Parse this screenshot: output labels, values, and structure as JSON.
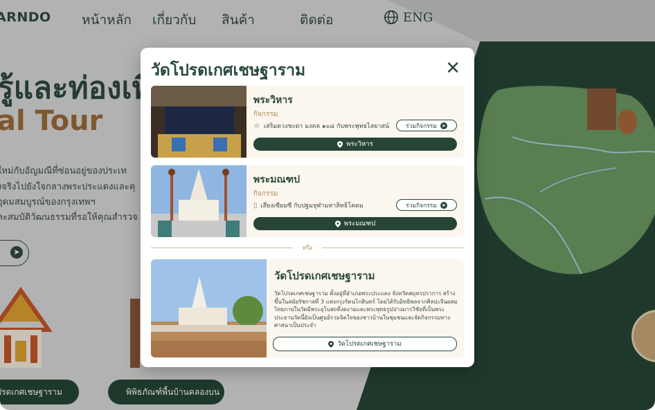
{
  "header": {
    "brand": "ARNDO",
    "nav": [
      "หน้าหลัก",
      "เกี่ยวกับ",
      "สินค้า",
      "ติดต่อ"
    ],
    "lang": "ENG"
  },
  "hero": {
    "title": "รู้และท่องเที่",
    "subtitle": "al Tour",
    "paragraph": [
      "ใหม่กับอัญมณีที่ซ่อนอยู่ของประเท",
      "งจริงไปยังใจกลางพระประแดงและคุ",
      "อุดมสมบูรณ์ของกรุงเทพฯ",
      "ละสมบัติวัฒนธรรมที่รอให้คุณสำรวจ"
    ],
    "pill_left": "โปรดเกศเชษฐาราม",
    "pill_right": "พิพิธภัณฑ์พื้นบ้านคลองบน"
  },
  "modal": {
    "title": "วัดโปรดเกศเชษฐาราม",
    "cards": [
      {
        "title": "พระวิหาร",
        "type": "กิจกรรม",
        "desc": "เสริมดวงชะตา มงคล ๑๐๘ กับพระพุทธไสยาสน์",
        "join": "ร่วมกิจกรรม",
        "location": "พระวิหาร"
      },
      {
        "title": "พระมณฑป",
        "type": "กิจกรรม",
        "desc": "เสี่ยงเซียมซี กับปฐมจุฬามหาสิทธิโคดม",
        "join": "ร่วมกิจกรรม",
        "location": "พระมณฑป"
      }
    ],
    "divider": "หรือ",
    "temple": {
      "title": "วัดโปรดเกศเชษฐาราม",
      "body": "วัดโปรดเกศเชษฐาราม ตั้งอยู่ที่อำเภอพระประแดง จังหวัดสมุทรปราการ สร้างขึ้นในสมัยรัชกาลที่ 3 แห่งกรุงรัตนโกสินทร์ โดยได้รับอิทธิพลจากศิลปะจีนผสมไทยภายในวัดมีพระอุโบสถที่งดงามและพระพุทธรูปปางมารวิชัยที่เป็นพระประธานวัดนี้ยังเป็นศูนย์รวมจิตใจของชาวบ้านในชุมชนและจัดกิจกรรมทางศาสนาเป็นประจำ",
      "button": "วัดโปรดเกศเชษฐาราม"
    }
  },
  "colors": {
    "dark_green": "#274536",
    "accent_brown": "#9b6b3a",
    "card_bg": "#fbf6ee",
    "map_green": "#6c9a63"
  },
  "icons": {
    "globe": "globe-icon",
    "close": "close-icon",
    "pin": "location-pin-icon",
    "arrow": "arrow-right-icon"
  }
}
